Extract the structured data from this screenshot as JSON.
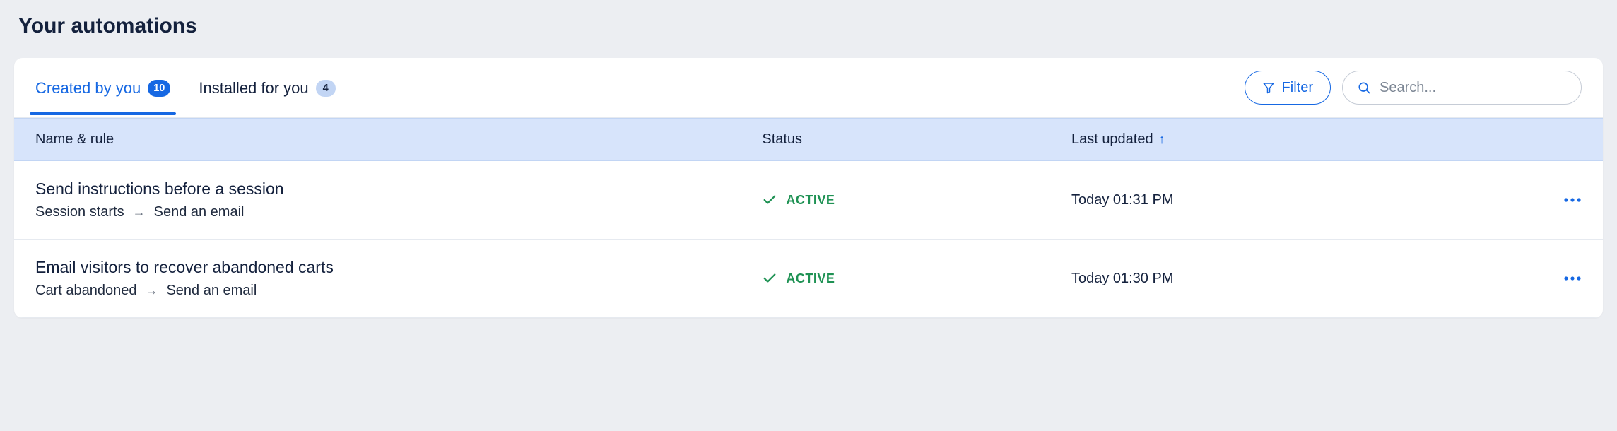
{
  "page_title": "Your automations",
  "tabs": [
    {
      "label": "Created by you",
      "count": "10",
      "active": true
    },
    {
      "label": "Installed for you",
      "count": "4",
      "active": false
    }
  ],
  "filter_label": "Filter",
  "search_placeholder": "Search...",
  "columns": {
    "name": "Name & rule",
    "status": "Status",
    "updated": "Last updated"
  },
  "rows": [
    {
      "title": "Send instructions before a session",
      "trigger": "Session starts",
      "action": "Send an email",
      "status": "ACTIVE",
      "updated": "Today 01:31 PM"
    },
    {
      "title": "Email visitors to recover abandoned carts",
      "trigger": "Cart abandoned",
      "action": "Send an email",
      "status": "ACTIVE",
      "updated": "Today 01:30 PM"
    }
  ]
}
